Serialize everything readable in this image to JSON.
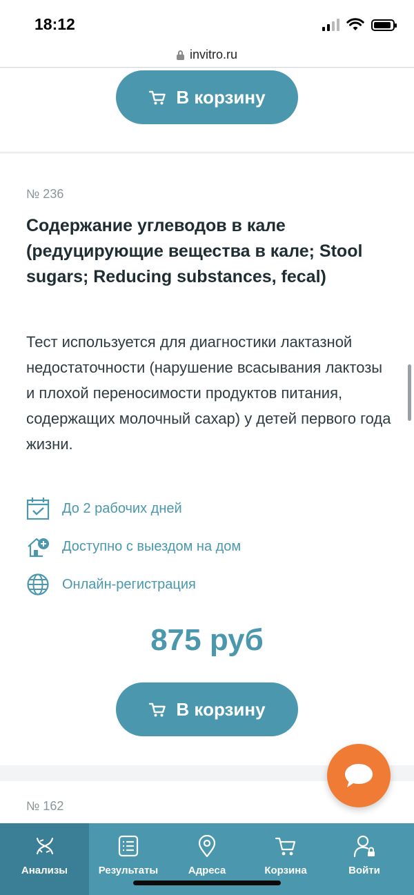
{
  "status_bar": {
    "time": "18:12"
  },
  "browser": {
    "url": "invitro.ru"
  },
  "cards": {
    "top_card": {
      "cart_button_label": "В корзину"
    },
    "main_card": {
      "number": "№ 236",
      "title": "Содержание углеводов в кале (редуцирующие вещества в кале; Stool sugars; Reducing substances, fecal)",
      "description": "Тест используется для диагностики лактазной недостаточности (нарушение всасывания лактозы и плохой переносимости продуктов питания, содержащих молочный сахар) у детей первого года жизни.",
      "features": [
        {
          "icon": "calendar-check-icon",
          "label": "До 2 рабочих дней"
        },
        {
          "icon": "home-plus-icon",
          "label": "Доступно с выездом на дом"
        },
        {
          "icon": "globe-icon",
          "label": "Онлайн-регистрация"
        }
      ],
      "price": "875 руб",
      "cart_button_label": "В корзину"
    },
    "next_card": {
      "number": "№ 162"
    }
  },
  "bottom_nav": {
    "items": [
      {
        "icon": "dna-icon",
        "label": "Анализы"
      },
      {
        "icon": "results-list-icon",
        "label": "Результаты"
      },
      {
        "icon": "location-pin-icon",
        "label": "Адреса"
      },
      {
        "icon": "cart-icon",
        "label": "Корзина"
      },
      {
        "icon": "user-login-icon",
        "label": "Войти"
      }
    ]
  },
  "colors": {
    "brand": "#4a97ae",
    "nav_active": "#3a7f95",
    "chat_fab": "#f07b34",
    "title_text": "#1f2d33",
    "muted_text": "#8b9599"
  }
}
